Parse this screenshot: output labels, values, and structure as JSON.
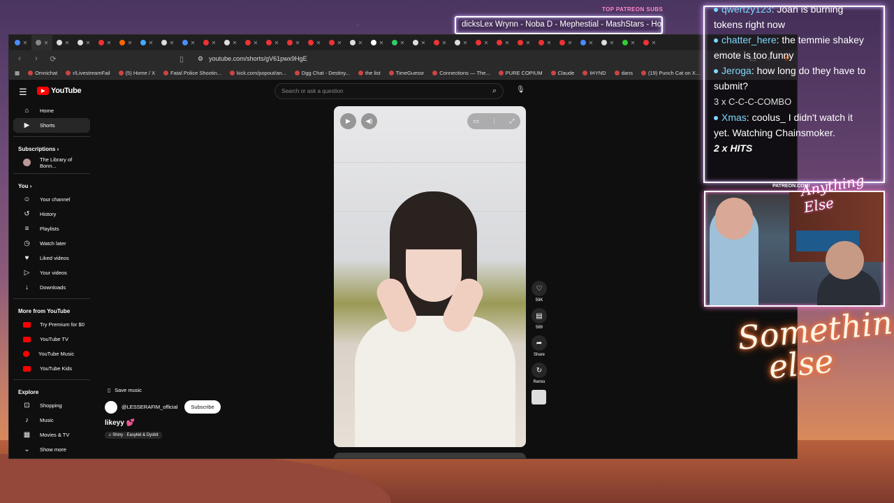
{
  "browser": {
    "url": "youtube.com/shorts/gV61pwx9HgE",
    "tabs": [
      "",
      "",
      "",
      "",
      "",
      "",
      "",
      "",
      "",
      "",
      "",
      "",
      "",
      "",
      "",
      "",
      "",
      "",
      "",
      "",
      "",
      "",
      "",
      "",
      "",
      "",
      "",
      "",
      "",
      "",
      ""
    ],
    "bookmarks": [
      "Omnichat",
      "r/LivestreamFail",
      "(5) Home / X",
      "Fatal Police Shootin...",
      "kick.com/popout/an...",
      "Dgg Chat - Destiny...",
      "the list",
      "TimeGuessr",
      "Connections — The...",
      "PURE COPIUM",
      "Claude",
      "IHYND",
      "dans",
      "(19) Punch Cat on X..."
    ]
  },
  "youtube": {
    "logo_text": "YouTube",
    "search_placeholder": "Search or ask a question",
    "nav": {
      "home": "Home",
      "shorts": "Shorts",
      "subscriptions": "Subscriptions",
      "sub_channel": "The Library of Bonn...",
      "you": "You",
      "your_channel": "Your channel",
      "history": "History",
      "playlists": "Playlists",
      "watch_later": "Watch later",
      "liked": "Liked videos",
      "your_videos": "Your videos",
      "downloads": "Downloads",
      "more_from": "More from YouTube",
      "premium": "Try Premium for $0",
      "tv": "YouTube TV",
      "music": "YouTube Music",
      "kids": "YouTube Kids",
      "explore": "Explore",
      "shopping": "Shopping",
      "music2": "Music",
      "movies": "Movies & TV",
      "show_more": "Show more"
    },
    "short": {
      "save_music": "Save music",
      "channel": "@LESSERAFIM_official",
      "subscribe": "Subscribe",
      "title": "likeyy 💕",
      "music_tag": "♫ Shiny · Easykid & Dysbit",
      "likes": "59K",
      "comments": "589",
      "share": "Share",
      "remix": "Remix"
    }
  },
  "overlay": {
    "subs_label": "TOP PATREON SUBS",
    "subs_text": "dicksLex Wrynn -  Noba D - Mephestial - MashStars - Hon",
    "chat": [
      {
        "name": "qwertzy123",
        "text": ": Joan is burning"
      },
      {
        "name": "",
        "text": "tokens right now"
      },
      {
        "name": "chatter_here",
        "text": ": the temmie shakey"
      },
      {
        "name": "",
        "text": "emote is too funny"
      },
      {
        "name": "Jeroga",
        "text": ": how long do they have to"
      },
      {
        "name": "",
        "text": "submit?"
      },
      {
        "name": "",
        "text": "3 x C-C-C-COMBO"
      },
      {
        "name": "Xmas",
        "text": ": coolus_  I didn't watch it"
      },
      {
        "name": "",
        "text": "yet. Watching Chainsmoker."
      },
      {
        "name": "",
        "text": "2 x HITS"
      }
    ],
    "patreon_tag": "PATREON.COM/",
    "cam_script": "Anything Else",
    "neon_line1": "Something",
    "neon_line2": "else"
  },
  "colors": {
    "accent": "#ff0000",
    "chat_name": "#7fd8ff"
  }
}
